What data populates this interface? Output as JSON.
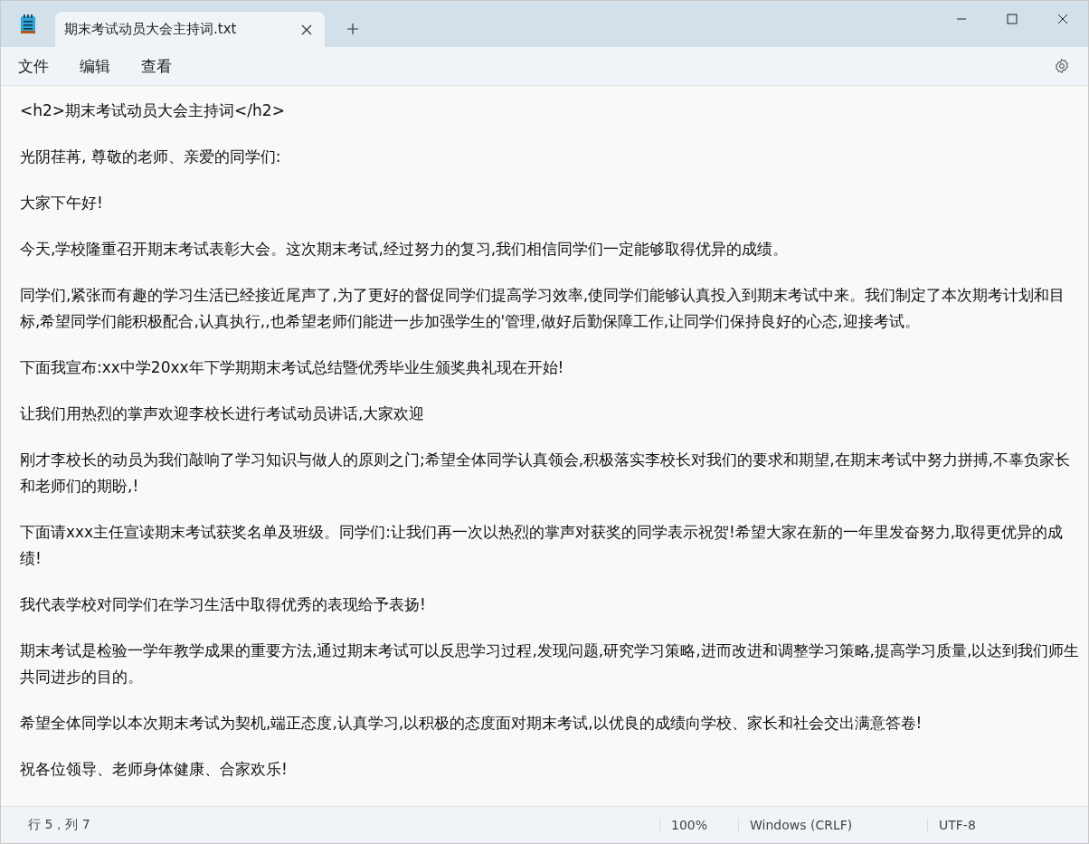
{
  "tabs": [
    {
      "title": "期末考试动员大会主持词.txt",
      "selected": true
    }
  ],
  "menu": [
    "文件",
    "编辑",
    "查看"
  ],
  "document": {
    "paragraphs": [
      "<h2>期末考试动员大会主持词</h2>",
      "光阴荏苒, 尊敬的老师、亲爱的同学们:",
      "大家下午好!",
      "今天,学校隆重召开期末考试表彰大会。这次期末考试,经过努力的复习,我们相信同学们一定能够取得优异的成绩。",
      "同学们,紧张而有趣的学习生活已经接近尾声了,为了更好的督促同学们提高学习效率,使同学们能够认真投入到期末考试中来。我们制定了本次期考计划和目标,希望同学们能积极配合,认真执行,,也希望老师们能进一步加强学生的'管理,做好后勤保障工作,让同学们保持良好的心态,迎接考试。",
      "下面我宣布:xx中学20xx年下学期期末考试总结暨优秀毕业生颁奖典礼现在开始!",
      "让我们用热烈的掌声欢迎李校长进行考试动员讲话,大家欢迎",
      "刚才李校长的动员为我们敲响了学习知识与做人的原则之门;希望全体同学认真领会,积极落实李校长对我们的要求和期望,在期末考试中努力拼搏,不辜负家长和老师们的期盼,!",
      "下面请xxx主任宣读期末考试获奖名单及班级。同学们:让我们再一次以热烈的掌声对获奖的同学表示祝贺!希望大家在新的一年里发奋努力,取得更优异的成绩!",
      "我代表学校对同学们在学习生活中取得优秀的表现给予表扬!",
      "期末考试是检验一学年教学成果的重要方法,通过期末考试可以反思学习过程,发现问题,研究学习策略,进而改进和调整学习策略,提高学习质量,以达到我们师生共同进步的目的。",
      "希望全体同学以本次期末考试为契机,端正态度,认真学习,以积极的态度面对期末考试,以优良的成绩向学校、家长和社会交出满意答卷!",
      "祝各位领导、老师身体健康、合家欢乐!"
    ]
  },
  "status_bar": {
    "position": "行 5，列 7",
    "zoom": "100%",
    "line_ending": "Windows (CRLF)",
    "encoding": "UTF-8"
  }
}
